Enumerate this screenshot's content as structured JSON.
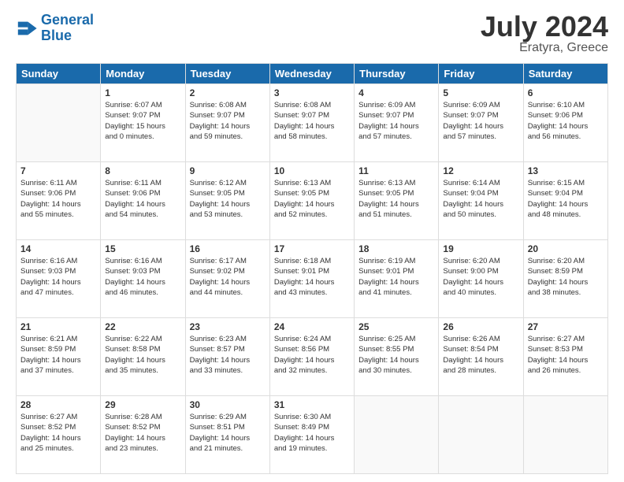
{
  "header": {
    "logo_line1": "General",
    "logo_line2": "Blue",
    "month": "July 2024",
    "location": "Eratyra, Greece"
  },
  "days_of_week": [
    "Sunday",
    "Monday",
    "Tuesday",
    "Wednesday",
    "Thursday",
    "Friday",
    "Saturday"
  ],
  "weeks": [
    [
      {
        "day": "",
        "info": ""
      },
      {
        "day": "1",
        "info": "Sunrise: 6:07 AM\nSunset: 9:07 PM\nDaylight: 15 hours\nand 0 minutes."
      },
      {
        "day": "2",
        "info": "Sunrise: 6:08 AM\nSunset: 9:07 PM\nDaylight: 14 hours\nand 59 minutes."
      },
      {
        "day": "3",
        "info": "Sunrise: 6:08 AM\nSunset: 9:07 PM\nDaylight: 14 hours\nand 58 minutes."
      },
      {
        "day": "4",
        "info": "Sunrise: 6:09 AM\nSunset: 9:07 PM\nDaylight: 14 hours\nand 57 minutes."
      },
      {
        "day": "5",
        "info": "Sunrise: 6:09 AM\nSunset: 9:07 PM\nDaylight: 14 hours\nand 57 minutes."
      },
      {
        "day": "6",
        "info": "Sunrise: 6:10 AM\nSunset: 9:06 PM\nDaylight: 14 hours\nand 56 minutes."
      }
    ],
    [
      {
        "day": "7",
        "info": "Sunrise: 6:11 AM\nSunset: 9:06 PM\nDaylight: 14 hours\nand 55 minutes."
      },
      {
        "day": "8",
        "info": "Sunrise: 6:11 AM\nSunset: 9:06 PM\nDaylight: 14 hours\nand 54 minutes."
      },
      {
        "day": "9",
        "info": "Sunrise: 6:12 AM\nSunset: 9:05 PM\nDaylight: 14 hours\nand 53 minutes."
      },
      {
        "day": "10",
        "info": "Sunrise: 6:13 AM\nSunset: 9:05 PM\nDaylight: 14 hours\nand 52 minutes."
      },
      {
        "day": "11",
        "info": "Sunrise: 6:13 AM\nSunset: 9:05 PM\nDaylight: 14 hours\nand 51 minutes."
      },
      {
        "day": "12",
        "info": "Sunrise: 6:14 AM\nSunset: 9:04 PM\nDaylight: 14 hours\nand 50 minutes."
      },
      {
        "day": "13",
        "info": "Sunrise: 6:15 AM\nSunset: 9:04 PM\nDaylight: 14 hours\nand 48 minutes."
      }
    ],
    [
      {
        "day": "14",
        "info": "Sunrise: 6:16 AM\nSunset: 9:03 PM\nDaylight: 14 hours\nand 47 minutes."
      },
      {
        "day": "15",
        "info": "Sunrise: 6:16 AM\nSunset: 9:03 PM\nDaylight: 14 hours\nand 46 minutes."
      },
      {
        "day": "16",
        "info": "Sunrise: 6:17 AM\nSunset: 9:02 PM\nDaylight: 14 hours\nand 44 minutes."
      },
      {
        "day": "17",
        "info": "Sunrise: 6:18 AM\nSunset: 9:01 PM\nDaylight: 14 hours\nand 43 minutes."
      },
      {
        "day": "18",
        "info": "Sunrise: 6:19 AM\nSunset: 9:01 PM\nDaylight: 14 hours\nand 41 minutes."
      },
      {
        "day": "19",
        "info": "Sunrise: 6:20 AM\nSunset: 9:00 PM\nDaylight: 14 hours\nand 40 minutes."
      },
      {
        "day": "20",
        "info": "Sunrise: 6:20 AM\nSunset: 8:59 PM\nDaylight: 14 hours\nand 38 minutes."
      }
    ],
    [
      {
        "day": "21",
        "info": "Sunrise: 6:21 AM\nSunset: 8:59 PM\nDaylight: 14 hours\nand 37 minutes."
      },
      {
        "day": "22",
        "info": "Sunrise: 6:22 AM\nSunset: 8:58 PM\nDaylight: 14 hours\nand 35 minutes."
      },
      {
        "day": "23",
        "info": "Sunrise: 6:23 AM\nSunset: 8:57 PM\nDaylight: 14 hours\nand 33 minutes."
      },
      {
        "day": "24",
        "info": "Sunrise: 6:24 AM\nSunset: 8:56 PM\nDaylight: 14 hours\nand 32 minutes."
      },
      {
        "day": "25",
        "info": "Sunrise: 6:25 AM\nSunset: 8:55 PM\nDaylight: 14 hours\nand 30 minutes."
      },
      {
        "day": "26",
        "info": "Sunrise: 6:26 AM\nSunset: 8:54 PM\nDaylight: 14 hours\nand 28 minutes."
      },
      {
        "day": "27",
        "info": "Sunrise: 6:27 AM\nSunset: 8:53 PM\nDaylight: 14 hours\nand 26 minutes."
      }
    ],
    [
      {
        "day": "28",
        "info": "Sunrise: 6:27 AM\nSunset: 8:52 PM\nDaylight: 14 hours\nand 25 minutes."
      },
      {
        "day": "29",
        "info": "Sunrise: 6:28 AM\nSunset: 8:52 PM\nDaylight: 14 hours\nand 23 minutes."
      },
      {
        "day": "30",
        "info": "Sunrise: 6:29 AM\nSunset: 8:51 PM\nDaylight: 14 hours\nand 21 minutes."
      },
      {
        "day": "31",
        "info": "Sunrise: 6:30 AM\nSunset: 8:49 PM\nDaylight: 14 hours\nand 19 minutes."
      },
      {
        "day": "",
        "info": ""
      },
      {
        "day": "",
        "info": ""
      },
      {
        "day": "",
        "info": ""
      }
    ]
  ]
}
